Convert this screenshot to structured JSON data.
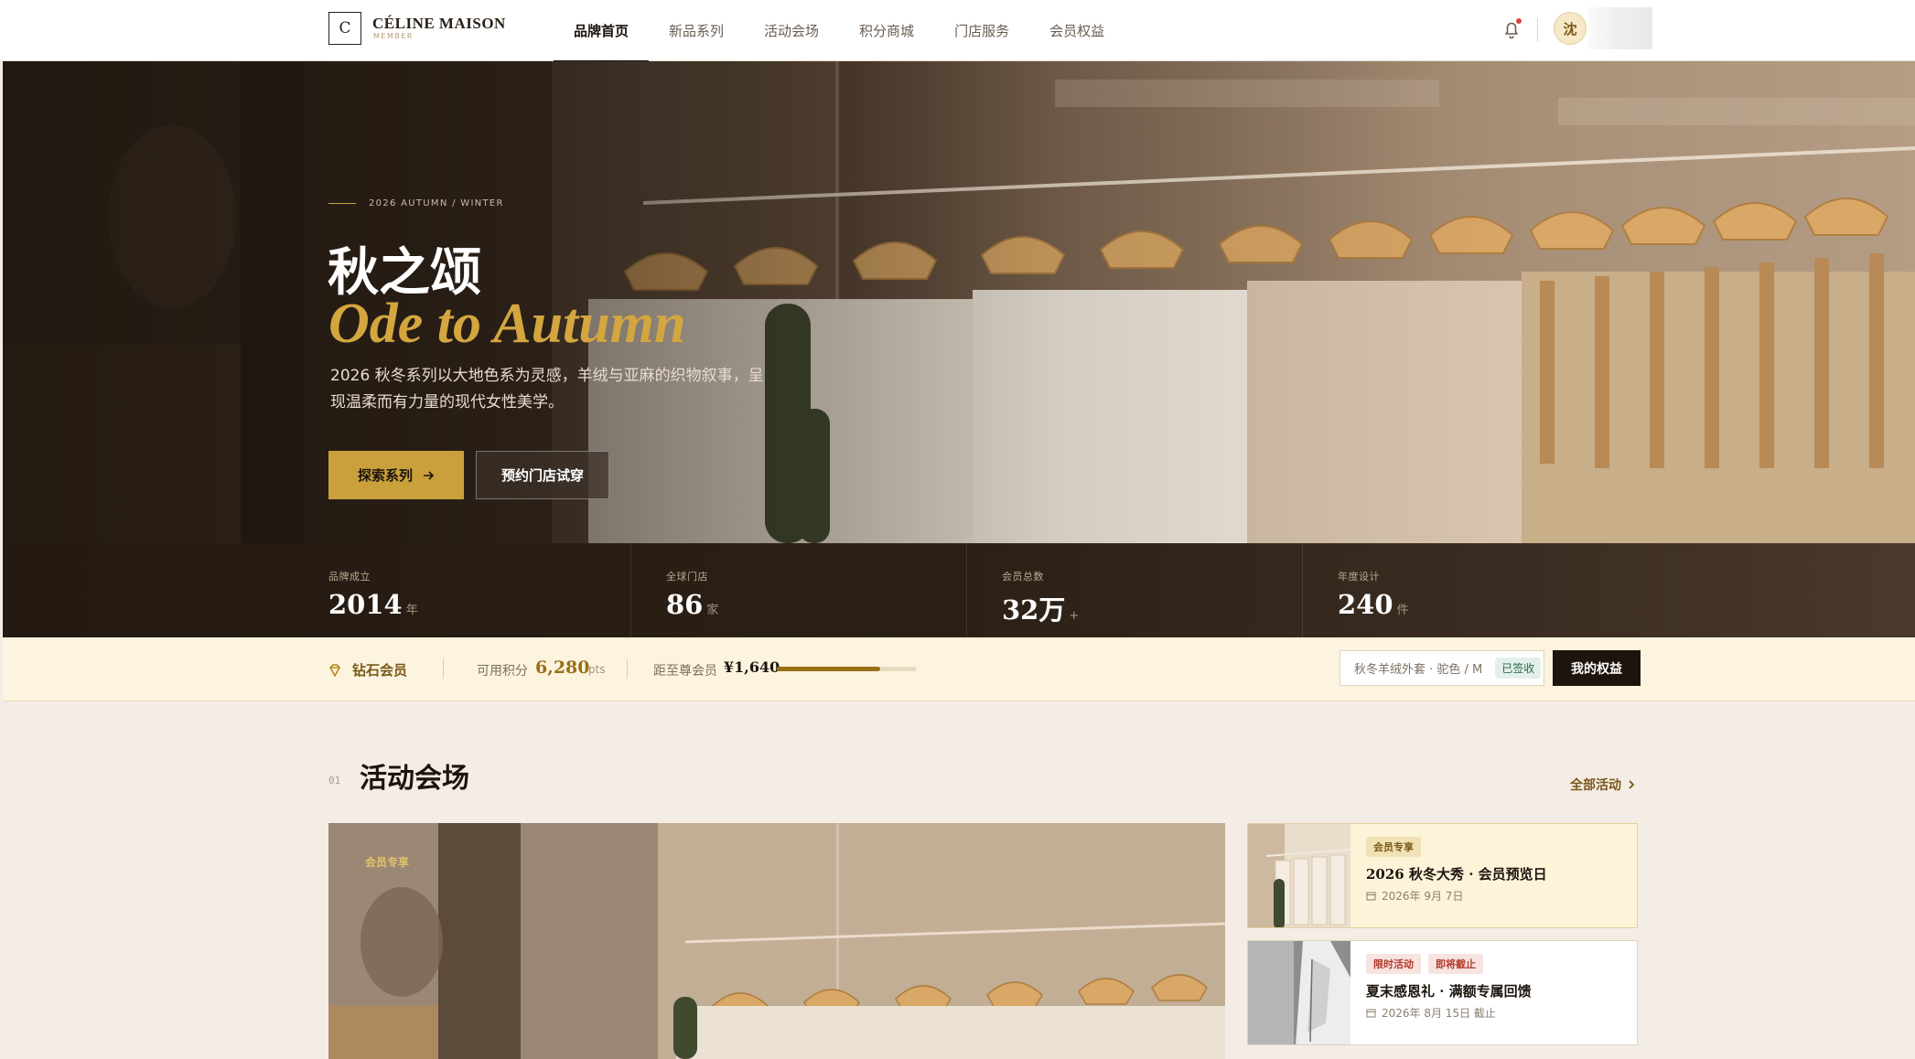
{
  "brand": {
    "logo_letter": "C",
    "name": "CÉLINE MAISON",
    "sub": "MEMBER"
  },
  "nav": [
    {
      "label": "品牌首页",
      "active": true
    },
    {
      "label": "新品系列",
      "active": false
    },
    {
      "label": "活动会场",
      "active": false
    },
    {
      "label": "积分商城",
      "active": false
    },
    {
      "label": "门店服务",
      "active": false
    },
    {
      "label": "会员权益",
      "active": false
    }
  ],
  "user": {
    "avatar_text": "沈"
  },
  "hero": {
    "eyebrow": "2026 AUTUMN / WINTER",
    "title": "秋之颂",
    "title_en": "Ode to Autumn",
    "description": "2026 秋冬系列以大地色系为灵感，羊绒与亚麻的织物叙事，呈现温柔而有力量的现代女性美学。",
    "primary_button": "探索系列",
    "secondary_button": "预约门店试穿"
  },
  "stats": [
    {
      "label": "品牌成立",
      "value": "2014",
      "unit": "年"
    },
    {
      "label": "全球门店",
      "value": "86",
      "unit": "家"
    },
    {
      "label": "会员总数",
      "value": "32万",
      "unit": "+"
    },
    {
      "label": "年度设计",
      "value": "240",
      "unit": "件"
    }
  ],
  "member": {
    "tier": "钻石会员",
    "points_label": "可用积分",
    "points_value": "6,280",
    "points_unit": "pts",
    "next_label": "距至尊会员",
    "next_value": "¥1,640",
    "progress": 0.74,
    "order_text": "秋冬羊绒外套 · 驼色 / M",
    "order_status": "已签收",
    "benefits_button": "我的权益"
  },
  "events_section": {
    "number": "01",
    "title": "活动会场",
    "link": "全部活动",
    "feature_tag": "会员专享",
    "cards": [
      {
        "tags": [
          "会员专享"
        ],
        "title": "2026 秋冬大秀 · 会员预览日",
        "date": "2026年 9月 7日"
      },
      {
        "tags": [
          "限时活动",
          "即将截止"
        ],
        "title": "夏末感恩礼 · 满额专属回馈",
        "date": "2026年 8月 15日 截止"
      }
    ]
  },
  "colors": {
    "gold": "#c9a03b",
    "dark": "#1c140d",
    "cream": "#fcf4df"
  }
}
